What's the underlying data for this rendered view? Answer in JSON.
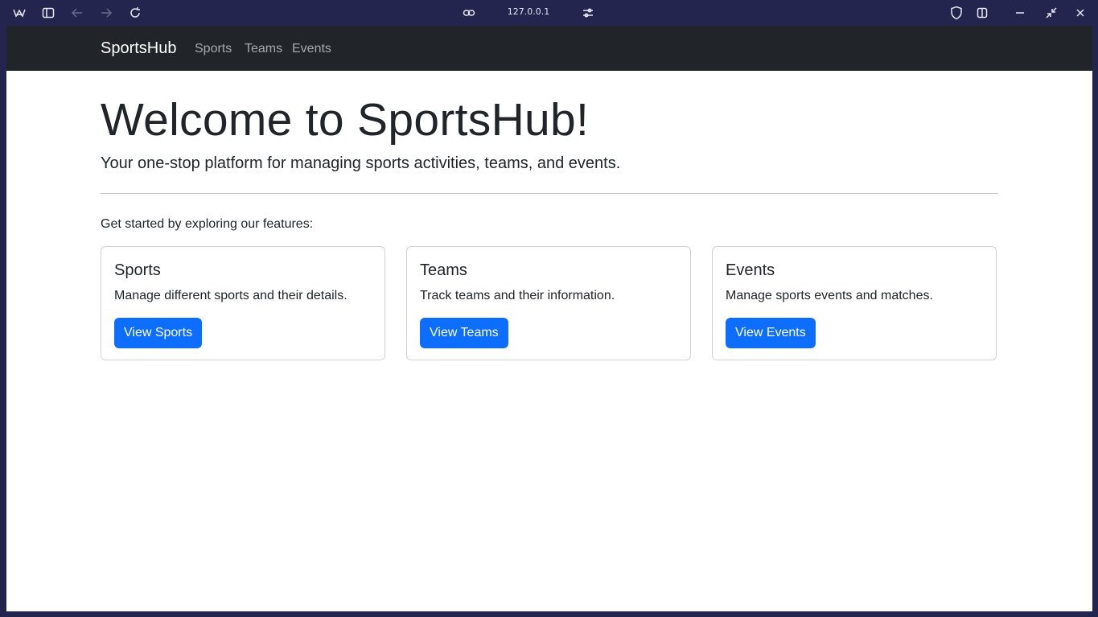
{
  "browser": {
    "url": "127.0.0.1",
    "icons": [
      "browser-logo-icon",
      "sidebar-toggle-icon",
      "back-icon",
      "forward-icon",
      "reload-icon",
      "link-icon",
      "site-settings-icon",
      "shield-icon",
      "split-view-icon",
      "minimize-icon",
      "restore-icon"
    ]
  },
  "navbar": {
    "brand": "SportsHub",
    "links": [
      "Sports",
      "Teams",
      "Events"
    ]
  },
  "hero": {
    "title": "Welcome to SportsHub!",
    "lead": "Your one-stop platform for managing sports activities, teams, and events."
  },
  "intro": "Get started by exploring our features:",
  "cards": [
    {
      "title": "Sports",
      "text": "Manage different sports and their details.",
      "button": "View Sports"
    },
    {
      "title": "Teams",
      "text": "Track teams and their information.",
      "button": "View Teams"
    },
    {
      "title": "Events",
      "text": "Manage sports events and matches.",
      "button": "View Events"
    }
  ],
  "colors": {
    "navbar_bg": "#212529",
    "primary": "#0d6efd",
    "chrome_bg": "#24254e"
  }
}
